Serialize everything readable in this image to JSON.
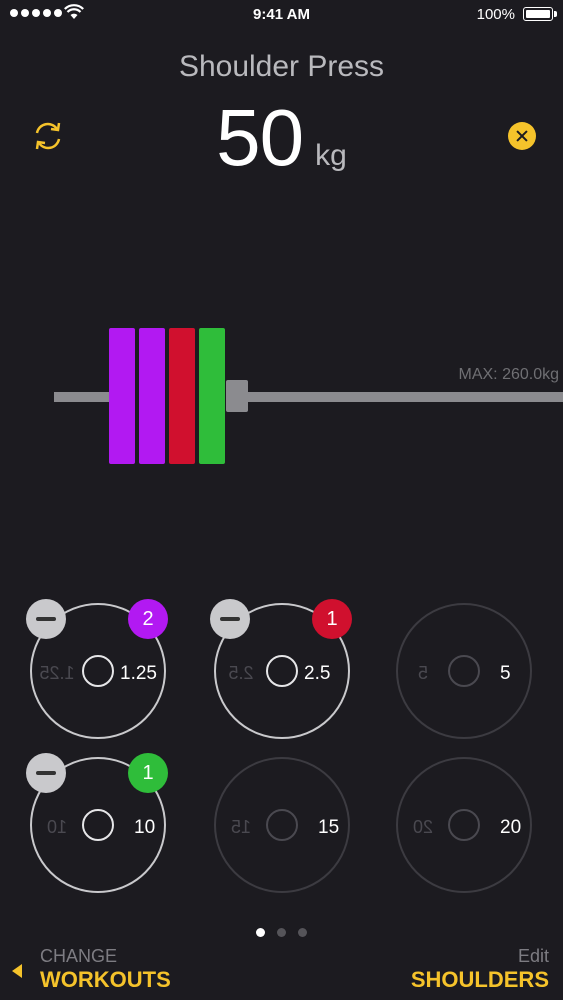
{
  "status_bar": {
    "time": "9:41 AM",
    "battery": "100%"
  },
  "exercise": {
    "title": "Shoulder Press",
    "weight": "50",
    "unit": "kg"
  },
  "barbell": {
    "max_label": "MAX: 260.0kg",
    "loaded_plates": [
      {
        "color": "#b219f2"
      },
      {
        "color": "#b219f2"
      },
      {
        "color": "#d0102e"
      },
      {
        "color": "#2fbd3a"
      }
    ]
  },
  "plates": [
    {
      "label": "1.25",
      "count": "2",
      "badge_color": "#b219f2",
      "active": true
    },
    {
      "label": "2.5",
      "count": "1",
      "badge_color": "#d0102e",
      "active": true
    },
    {
      "label": "5",
      "count": null,
      "active": false
    },
    {
      "label": "10",
      "count": "1",
      "badge_color": "#2fbd3a",
      "active": true
    },
    {
      "label": "15",
      "count": null,
      "active": false
    },
    {
      "label": "20",
      "count": null,
      "active": false
    }
  ],
  "pager": {
    "pages": 3,
    "current": 1
  },
  "footer": {
    "left_small": "CHANGE",
    "left_big": "WORKOUTS",
    "right_small": "Edit",
    "right_big": "SHOULDERS"
  },
  "colors": {
    "accent": "#f5c32b",
    "background": "#1c1b20"
  }
}
